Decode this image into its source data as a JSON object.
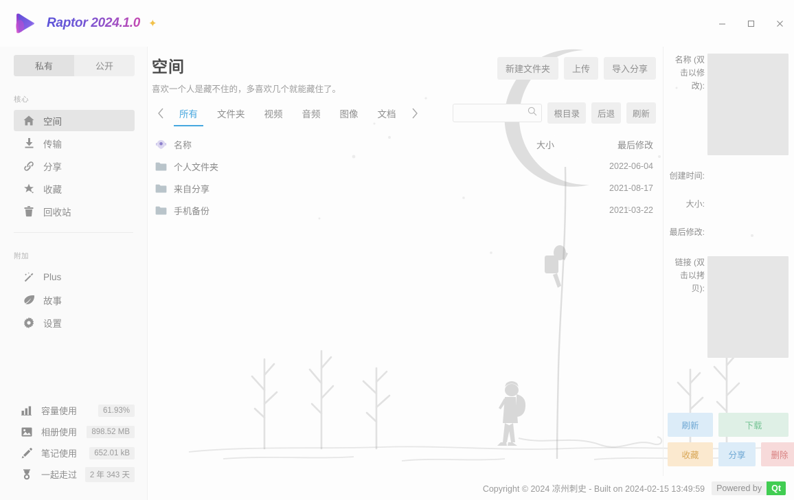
{
  "window": {
    "app_name": "Raptor 2024.1.0",
    "logo_icon": "play-triangle-gradient-logo",
    "star_icon": "star-icon",
    "minimize_icon": "minimize-icon",
    "maximize_icon": "maximize-icon",
    "close_icon": "close-icon"
  },
  "sidebar": {
    "toggle": {
      "private": "私有",
      "public": "公开",
      "selected": "私有"
    },
    "group_core_label": "核心",
    "core_items": [
      {
        "label": "空间",
        "icon": "home-icon",
        "active": true
      },
      {
        "label": "传输",
        "icon": "download-icon",
        "active": false
      },
      {
        "label": "分享",
        "icon": "link-icon",
        "active": false
      },
      {
        "label": "收藏",
        "icon": "star-icon",
        "active": false
      },
      {
        "label": "回收站",
        "icon": "trash-icon",
        "active": false
      }
    ],
    "group_extra_label": "附加",
    "extra_items": [
      {
        "label": "Plus",
        "icon": "magic-wand-icon",
        "active": false
      },
      {
        "label": "故事",
        "icon": "leaf-icon",
        "active": false
      },
      {
        "label": "设置",
        "icon": "gear-icon",
        "active": false
      }
    ],
    "stats": [
      {
        "label": "容量使用",
        "value": "61.93%",
        "icon": "bar-chart-icon"
      },
      {
        "label": "相册使用",
        "value": "898.52 MB",
        "icon": "image-icon"
      },
      {
        "label": "笔记使用",
        "value": "652.01 kB",
        "icon": "pencil-icon"
      },
      {
        "label": "一起走过",
        "value": "2 年 343 天",
        "icon": "medal-icon"
      }
    ]
  },
  "main": {
    "title": "空间",
    "subtitle": "喜欢一个人是藏不住的，多喜欢几个就能藏住了。",
    "top_actions": [
      {
        "label": "新建文件夹",
        "name": "new-folder-button"
      },
      {
        "label": "上传",
        "name": "upload-button"
      },
      {
        "label": "导入分享",
        "name": "import-share-button"
      }
    ],
    "tabs": {
      "prev_icon": "chevron-left-icon",
      "next_icon": "chevron-right-icon",
      "items": [
        "所有",
        "文件夹",
        "视频",
        "音频",
        "图像",
        "文档"
      ],
      "active": "所有"
    },
    "search": {
      "value": "",
      "placeholder": "",
      "icon": "search-icon"
    },
    "nav_buttons": [
      {
        "label": "根目录",
        "name": "root-directory-button"
      },
      {
        "label": "后退",
        "name": "back-button"
      },
      {
        "label": "刷新",
        "name": "refresh-list-button"
      }
    ],
    "table": {
      "header_icon": "emblem-icon",
      "columns": {
        "name": "名称",
        "size": "大小",
        "modified": "最后修改"
      },
      "rows": [
        {
          "icon": "folder-icon",
          "name": "个人文件夹",
          "size": "",
          "modified": "2022-06-04"
        },
        {
          "icon": "folder-icon",
          "name": "来自分享",
          "size": "",
          "modified": "2021-08-17"
        },
        {
          "icon": "folder-icon",
          "name": "手机备份",
          "size": "",
          "modified": "2021-03-22"
        }
      ]
    }
  },
  "detail": {
    "fields": [
      {
        "label": "名称 (双击以修改):",
        "value": ""
      },
      {
        "label": "创建时间:",
        "value": ""
      },
      {
        "label": "大小:",
        "value": ""
      },
      {
        "label": "最后修改:",
        "value": ""
      },
      {
        "label": "链接 (双击以拷贝):",
        "value": ""
      }
    ],
    "buttons": {
      "refresh": "刷新",
      "download": "下载",
      "favorite": "收藏",
      "share": "分享",
      "delete": "删除"
    }
  },
  "footer": {
    "copyright": "Copyright © 2024 凉州刺史 - Built on 2024-02-15 13:49:59",
    "powered_by": "Powered by",
    "qt_badge": "Qt"
  },
  "colors": {
    "accent_blue": "#46a7df",
    "qt_green": "#41cd52",
    "logo_purple": "#6f57d6",
    "danger_red": "#d98282",
    "warn_orange": "#d9a859"
  }
}
